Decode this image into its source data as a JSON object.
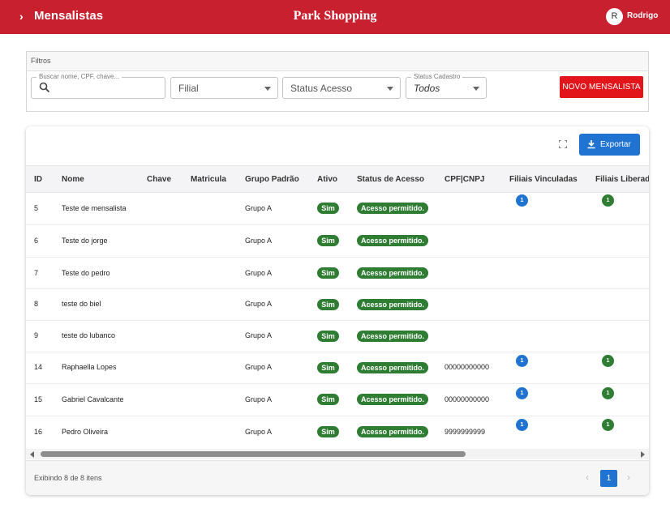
{
  "topbar": {
    "title": "Mensalistas",
    "location": "Park Shopping",
    "avatar_initial": "R",
    "user_name": "Rodrigo",
    "color": "#c8202f"
  },
  "filters": {
    "section_title": "Filtros",
    "search_label": "Buscar nome, CPF, chave...",
    "filial_placeholder": "Filial",
    "status_acesso_placeholder": "Status Acesso",
    "status_cadastro_label": "Status Cadastro",
    "status_cadastro_value": "Todos",
    "new_button": "NOVO MENSALISTA"
  },
  "toolbar": {
    "export_label": "Exportar",
    "export_color": "#2173d2"
  },
  "table": {
    "columns": [
      "ID",
      "Nome",
      "Chave",
      "Matricula",
      "Grupo Padrão",
      "Ativo",
      "Status de Acesso",
      "CPF|CNPJ",
      "Filiais Vinculadas",
      "Filiais Liberad"
    ],
    "rows": [
      {
        "id": "5",
        "nome": "Teste de mensalista",
        "chave": "",
        "matricula": "",
        "grupo": "Grupo A",
        "ativo": "Sim",
        "status": "Acesso permitido.",
        "cpf": "",
        "vinc": "1",
        "lib": "1"
      },
      {
        "id": "6",
        "nome": "Teste do jorge",
        "chave": "",
        "matricula": "",
        "grupo": "Grupo A",
        "ativo": "Sim",
        "status": "Acesso permitido.",
        "cpf": "",
        "vinc": "",
        "lib": ""
      },
      {
        "id": "7",
        "nome": "Teste do pedro",
        "chave": "",
        "matricula": "",
        "grupo": "Grupo A",
        "ativo": "Sim",
        "status": "Acesso permitido.",
        "cpf": "",
        "vinc": "",
        "lib": ""
      },
      {
        "id": "8",
        "nome": "teste do biel",
        "chave": "",
        "matricula": "",
        "grupo": "Grupo A",
        "ativo": "Sim",
        "status": "Acesso permitido.",
        "cpf": "",
        "vinc": "",
        "lib": ""
      },
      {
        "id": "9",
        "nome": "teste do lubanco",
        "chave": "",
        "matricula": "",
        "grupo": "Grupo A",
        "ativo": "Sim",
        "status": "Acesso permitido.",
        "cpf": "",
        "vinc": "",
        "lib": ""
      },
      {
        "id": "14",
        "nome": "Raphaella Lopes",
        "chave": "",
        "matricula": "",
        "grupo": "Grupo A",
        "ativo": "Sim",
        "status": "Acesso permitido.",
        "cpf": "00000000000",
        "vinc": "1",
        "lib": "1"
      },
      {
        "id": "15",
        "nome": "Gabriel Cavalcante",
        "chave": "",
        "matricula": "",
        "grupo": "Grupo A",
        "ativo": "Sim",
        "status": "Acesso permitido.",
        "cpf": "00000000000",
        "vinc": "1",
        "lib": "1"
      },
      {
        "id": "16",
        "nome": "Pedro Oliveira",
        "chave": "",
        "matricula": "",
        "grupo": "Grupo A",
        "ativo": "Sim",
        "status": "Acesso permitido.",
        "cpf": "9999999999",
        "vinc": "1",
        "lib": "1"
      }
    ]
  },
  "footer": {
    "info": "Exibindo 8 de 8 itens",
    "current_page": "1",
    "prev_icon": "‹",
    "next_icon": "›"
  },
  "colors": {
    "pill_green": "#2e7d32",
    "badge_blue": "#2173d2",
    "badge_green": "#2e7d32",
    "red_button": "#e2151a"
  }
}
